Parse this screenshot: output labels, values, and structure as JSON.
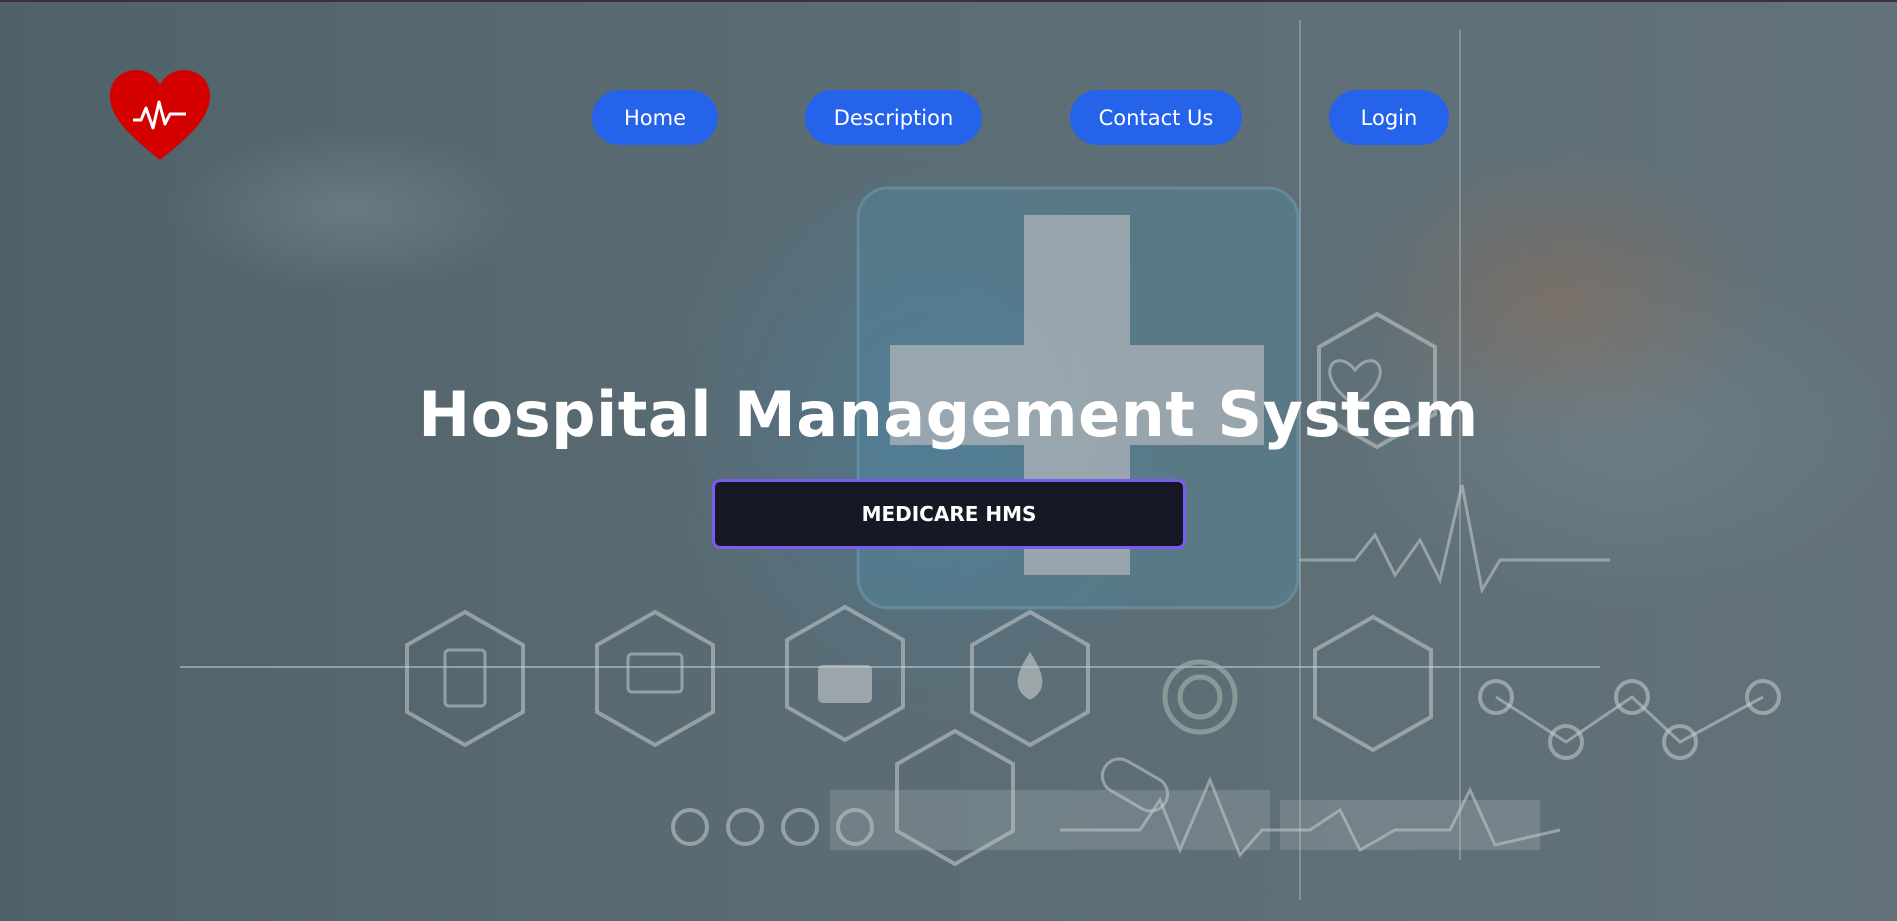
{
  "nav": {
    "home": "Home",
    "description": "Description",
    "contact": "Contact Us",
    "login": "Login"
  },
  "hero": {
    "title": "Hospital Management System",
    "cta": "MEDICARE HMS"
  },
  "logo": {
    "icon": "heart-pulse-icon"
  },
  "colors": {
    "nav_button": "#2563eb",
    "cta_bg": "#161826",
    "cta_border": "#7c5cf0",
    "logo_red": "#d40000"
  }
}
